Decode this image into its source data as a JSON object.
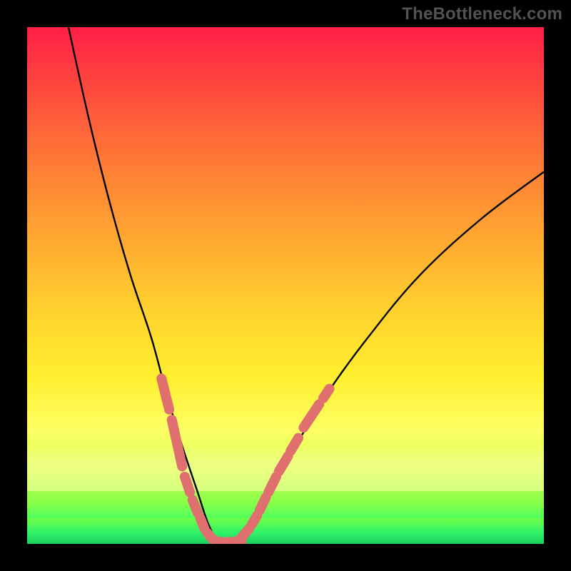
{
  "watermark": {
    "text": "TheBottleneck.com"
  },
  "colors": {
    "background": "#000000",
    "watermark": "#525252",
    "curve": "#000000",
    "beads": "#e07070"
  },
  "chart_data": {
    "type": "line",
    "title": "",
    "xlabel": "",
    "ylabel": "",
    "xlim": [
      0,
      100
    ],
    "ylim": [
      0,
      100
    ],
    "annotations": [
      "TheBottleneck.com"
    ],
    "series": [
      {
        "name": "left-branch",
        "x": [
          8,
          12,
          16,
          20,
          24,
          27,
          30,
          33,
          35,
          37
        ],
        "values": [
          100,
          82,
          66,
          52,
          40,
          29,
          19,
          10,
          4,
          0
        ]
      },
      {
        "name": "right-branch",
        "x": [
          40,
          43,
          47,
          52,
          58,
          66,
          76,
          88,
          100
        ],
        "values": [
          0,
          3,
          10,
          19,
          29,
          40,
          52,
          63,
          72
        ]
      },
      {
        "name": "minimum-flat",
        "x": [
          37,
          38,
          39,
          40
        ],
        "values": [
          0,
          0,
          0,
          0
        ]
      }
    ],
    "bead_segments_left": [
      {
        "x0": 26,
        "y0": 32,
        "x1": 27.5,
        "y1": 26
      },
      {
        "x0": 28,
        "y0": 24,
        "x1": 30,
        "y1": 15
      },
      {
        "x0": 30.5,
        "y0": 13,
        "x1": 31.5,
        "y1": 10
      },
      {
        "x0": 32,
        "y0": 8.5,
        "x1": 33,
        "y1": 6
      },
      {
        "x0": 33.5,
        "y0": 5,
        "x1": 34.3,
        "y1": 3
      },
      {
        "x0": 34.8,
        "y0": 2.2,
        "x1": 35.8,
        "y1": 1
      },
      {
        "x0": 36.2,
        "y0": 0.7,
        "x1": 37.5,
        "y1": 0.2
      }
    ],
    "bead_segments_right": [
      {
        "x0": 39.5,
        "y0": 0.2,
        "x1": 41,
        "y1": 0.7
      },
      {
        "x0": 41.5,
        "y0": 1.2,
        "x1": 43,
        "y1": 3
      },
      {
        "x0": 43.5,
        "y0": 3.8,
        "x1": 44.5,
        "y1": 5.5
      },
      {
        "x0": 45,
        "y0": 6.5,
        "x1": 46.2,
        "y1": 9
      },
      {
        "x0": 46.7,
        "y0": 10,
        "x1": 48.2,
        "y1": 13
      },
      {
        "x0": 48.7,
        "y0": 14,
        "x1": 50.5,
        "y1": 17
      },
      {
        "x0": 51,
        "y0": 18,
        "x1": 52.5,
        "y1": 20.5
      },
      {
        "x0": 53.5,
        "y0": 22.5,
        "x1": 56.5,
        "y1": 27
      },
      {
        "x0": 57.3,
        "y0": 28.2,
        "x1": 58.5,
        "y1": 30
      }
    ],
    "bead_bottom": {
      "x0": 36.5,
      "y0": 0.35,
      "x1": 41.5,
      "y1": 0.35
    }
  }
}
